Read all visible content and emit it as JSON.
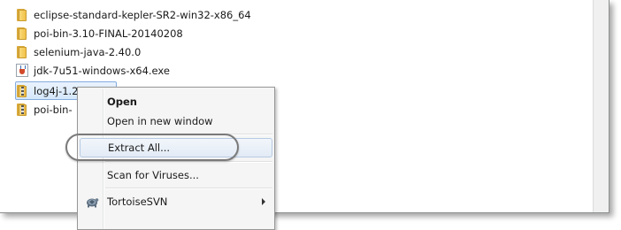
{
  "files": [
    {
      "name": "eclipse-standard-kepler-SR2-win32-x86_64",
      "icon": "folder-icon"
    },
    {
      "name": "poi-bin-3.10-FINAL-20140208",
      "icon": "folder-icon"
    },
    {
      "name": "selenium-java-2.40.0",
      "icon": "folder-icon"
    },
    {
      "name": "jdk-7u51-windows-x64.exe",
      "icon": "java-exe-icon"
    },
    {
      "name": "log4j-1.2.17.zip",
      "icon": "zip-folder-icon",
      "selected": true
    },
    {
      "name": "poi-bin-",
      "icon": "zip-folder-icon"
    }
  ],
  "context_menu": {
    "open": "Open",
    "open_new_window": "Open in new window",
    "extract_all": "Extract All...",
    "scan": "Scan for Viruses...",
    "tortoise": "TortoiseSVN"
  },
  "colors": {
    "selection_border": "#84acdd",
    "highlight_ring": "#7a7a7a"
  }
}
